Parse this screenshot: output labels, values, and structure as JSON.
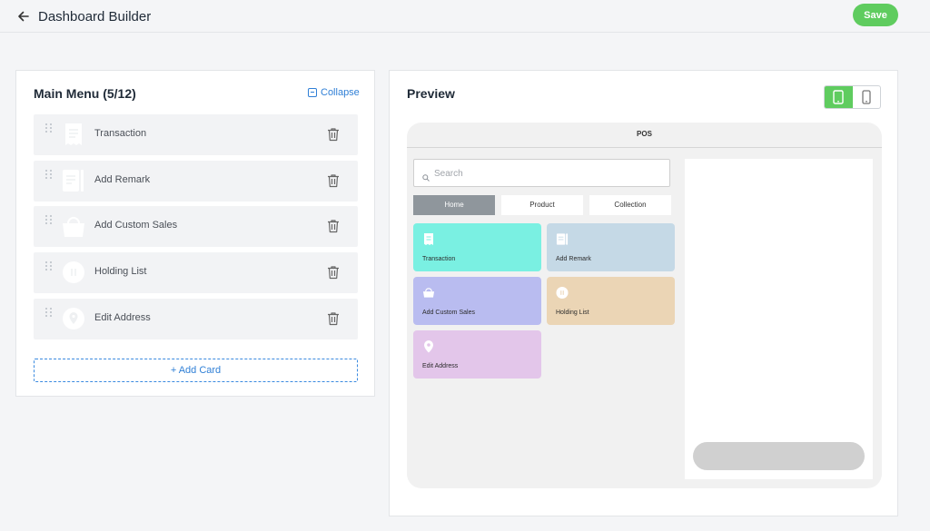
{
  "header": {
    "title": "Dashboard Builder",
    "save_label": "Save",
    "back_icon": "arrow-left-icon"
  },
  "menu": {
    "title": "Main Menu (5/12)",
    "collapse_label": "Collapse",
    "add_card_label": "+ Add Card",
    "items": [
      {
        "label": "Transaction",
        "icon": "receipt-icon"
      },
      {
        "label": "Add Remark",
        "icon": "note-icon"
      },
      {
        "label": "Add Custom Sales",
        "icon": "basket-icon"
      },
      {
        "label": "Holding List",
        "icon": "pause-icon"
      },
      {
        "label": "Edit Address",
        "icon": "location-pin-icon"
      }
    ]
  },
  "preview": {
    "title": "Preview",
    "device_modes": [
      "tablet-icon",
      "phone-icon"
    ],
    "active_device": "tablet",
    "device_header": "POS",
    "search_placeholder": "Search",
    "tabs": [
      {
        "label": "Home",
        "active": true
      },
      {
        "label": "Product",
        "active": false
      },
      {
        "label": "Collection",
        "active": false
      }
    ],
    "tiles": [
      {
        "label": "Transaction",
        "color": "#7af0e2"
      },
      {
        "label": "Add Remark",
        "color": "#c5d9e6"
      },
      {
        "label": "Add Custom Sales",
        "color": "#b9bcf0"
      },
      {
        "label": "Holding List",
        "color": "#ebd5b5"
      },
      {
        "label": "Edit Address",
        "color": "#e3c6ea"
      }
    ]
  },
  "colors": {
    "accent_green": "#5fcc5f",
    "link_blue": "#2f7fd6"
  }
}
